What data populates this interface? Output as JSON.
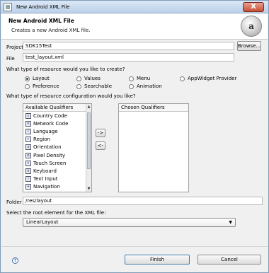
{
  "window": {
    "title": "New Android XML File",
    "close_label": "X"
  },
  "header": {
    "title": "New Android XML File",
    "subtitle": "Creates a new Android XML file.",
    "logo_text": "a"
  },
  "project": {
    "label": "Project",
    "value": "SDK15Test",
    "browse_label": "Browse..."
  },
  "file": {
    "label": "File",
    "value": "test_layout.xml"
  },
  "resource_type": {
    "question": "What type of resource would you like to create?",
    "options": [
      "Layout",
      "Values",
      "Menu",
      "AppWidget Provider",
      "Preference",
      "Searchable",
      "Animation"
    ],
    "selected": "Layout"
  },
  "configuration": {
    "question": "What type of resource configuration would you like?",
    "available_header": "Available Qualifiers",
    "chosen_header": "Chosen Qualifiers",
    "add_label": "->",
    "remove_label": "<-",
    "qualifiers": [
      "Country Code",
      "Network Code",
      "Language",
      "Region",
      "Orientation",
      "Pixel Density",
      "Touch Screen",
      "Keyboard",
      "Text Input",
      "Navigation"
    ]
  },
  "folder": {
    "label": "Folder",
    "value": "/res/layout"
  },
  "root_element": {
    "question": "Select the root element for the XML file:",
    "value": "LinearLayout"
  },
  "footer": {
    "help_icon": "?",
    "finish_label": "Finish",
    "cancel_label": "Cancel"
  },
  "icons": [
    "window-icon",
    "close-icon",
    "logo-icon",
    "qualifier-icons",
    "help-icon",
    "dropdown-arrow-icon"
  ]
}
